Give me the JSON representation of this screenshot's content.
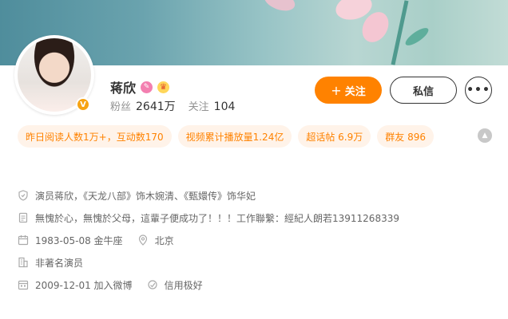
{
  "profile": {
    "name": "蒋欣",
    "verified_badge": "V",
    "badges": [
      {
        "icon": "pink-level-icon",
        "glyph": "✎"
      },
      {
        "icon": "crown-icon",
        "glyph": "♛"
      }
    ],
    "fans_label": "粉丝",
    "fans_value": "2641万",
    "following_label": "关注",
    "following_value": "104"
  },
  "actions": {
    "follow_plus": "+",
    "follow_label": "关注",
    "message_label": "私信",
    "more_label": "•••"
  },
  "tags": [
    "昨日阅读人数1万+，互动数170",
    "视频累计播放量1.24亿",
    "超话帖 6.9万",
    "群友 896"
  ],
  "collapse_glyph": "▲",
  "info": {
    "verification": "演员蒋欣，《天龙八部》饰木婉清、《甄嬛传》饰华妃",
    "bio": "無愧於心，無愧於父母，這輩子便成功了！！！工作聯繫：經紀人朗若13911268339",
    "birthday": "1983-05-08 金牛座",
    "location": "北京",
    "career": "非著名演员",
    "joined": "2009-12-01 加入微博",
    "credit": "信用极好"
  },
  "colors": {
    "accent": "#ff8200",
    "tag_bg": "#fff3e9",
    "verified": "#f7a313"
  }
}
